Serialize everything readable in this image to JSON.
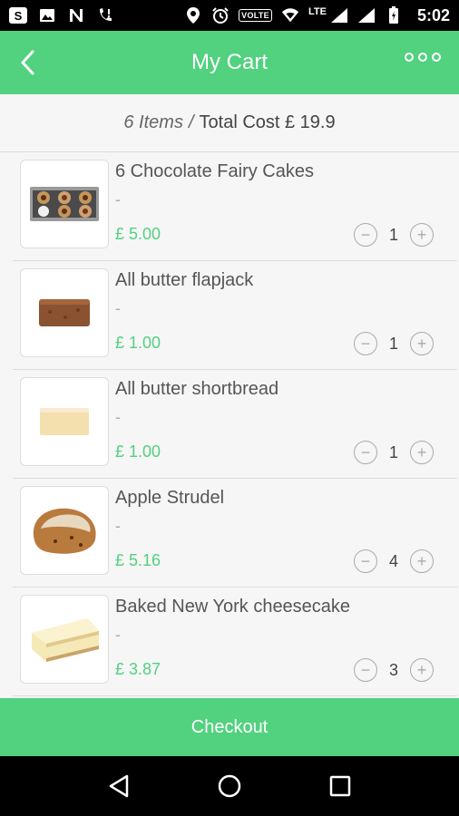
{
  "status_bar": {
    "lte_label": "LTE",
    "volte_label": "VOLTE",
    "time": "5:02",
    "icons": [
      "skype-icon",
      "image-icon",
      "n-icon",
      "missed-call-icon",
      "location-icon",
      "alarm-icon",
      "volte-icon",
      "wifi-icon",
      "signal-icon",
      "signal-icon-2",
      "battery-icon"
    ]
  },
  "header": {
    "title": "My Cart",
    "back_icon": "chevron-left-icon",
    "more_icon": "more-dots-icon"
  },
  "summary": {
    "items_count": "6 Items",
    "separator": "/",
    "total_label": "Total Cost £ 19.9"
  },
  "cart": {
    "items": [
      {
        "name": "6 Chocolate Fairy Cakes",
        "description": "-",
        "price": "£ 5.00",
        "quantity": "1",
        "image": "fairy-cakes-image"
      },
      {
        "name": "All butter flapjack",
        "description": "-",
        "price": "£ 1.00",
        "quantity": "1",
        "image": "flapjack-image"
      },
      {
        "name": "All butter shortbread",
        "description": "-",
        "price": "£ 1.00",
        "quantity": "1",
        "image": "shortbread-image"
      },
      {
        "name": "Apple Strudel",
        "description": "-",
        "price": "£ 5.16",
        "quantity": "4",
        "image": "strudel-image"
      },
      {
        "name": "Baked New York cheesecake",
        "description": "-",
        "price": "£ 3.87",
        "quantity": "3",
        "image": "cheesecake-image"
      }
    ]
  },
  "checkout": {
    "label": "Checkout"
  },
  "colors": {
    "accent": "#52d17f",
    "background": "#f6f6f6"
  }
}
